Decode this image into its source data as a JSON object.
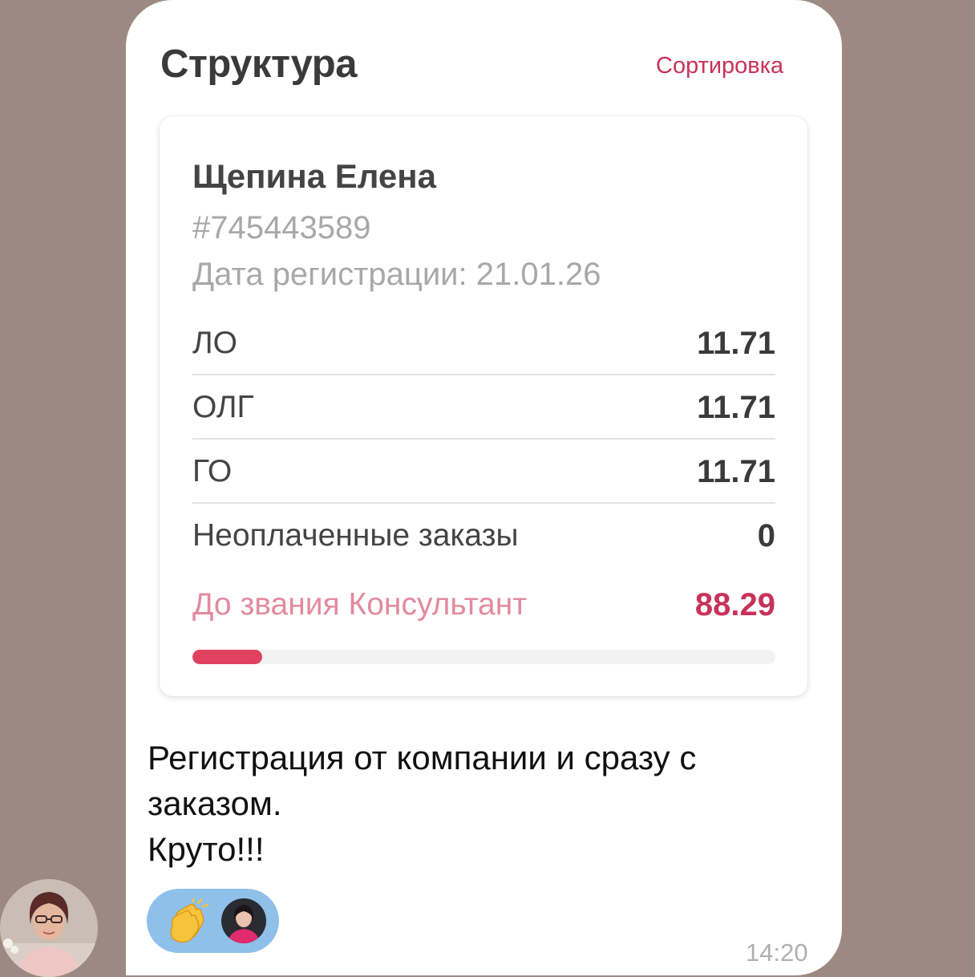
{
  "header": {
    "title": "Структура",
    "sort_label": "Сортировка"
  },
  "card": {
    "name": "Щепина Елена",
    "id": "#745443589",
    "registration": "Дата регистрации: 21.01.26",
    "rows": [
      {
        "label": "ЛО",
        "value": "11.71"
      },
      {
        "label": "ОЛГ",
        "value": "11.71"
      },
      {
        "label": "ГО",
        "value": "11.71"
      },
      {
        "label": "Неоплаченные заказы",
        "value": "0"
      }
    ],
    "rank": {
      "label": "До звания Консультант",
      "value": "88.29"
    },
    "progress_fraction": 0.12,
    "colors": {
      "accent": "#c8325a",
      "progress": "#e0415f"
    }
  },
  "message": {
    "lines": [
      "Регистрация от компании и сразу с",
      "заказом.",
      "Круто!!!"
    ],
    "time": "14:20"
  },
  "reaction": {
    "emoji_icon": "clapping-hands-icon",
    "reactor_avatar": "reactor-avatar"
  },
  "sender": {
    "avatar": "sender-avatar"
  }
}
